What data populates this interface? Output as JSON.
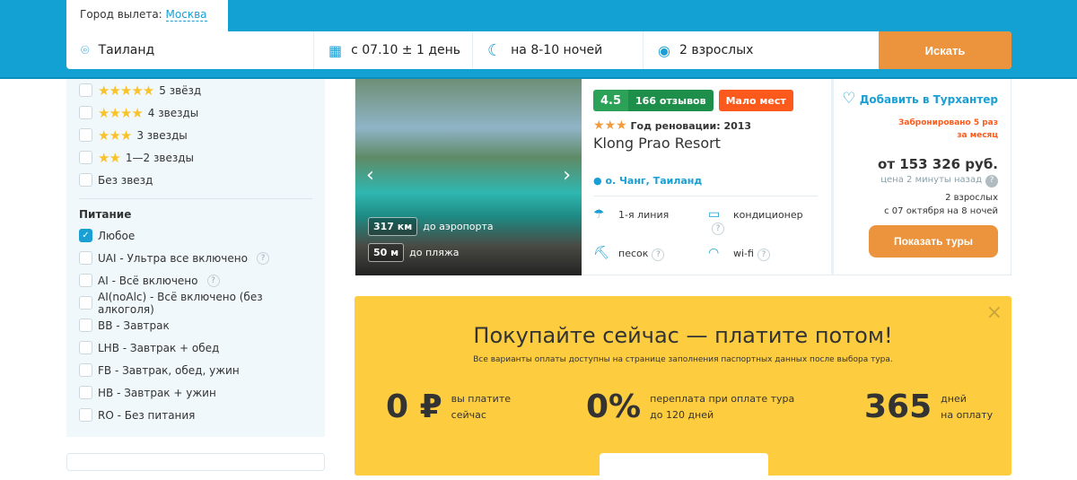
{
  "header": {
    "city_label": "Город вылета:",
    "city_value": "Москва",
    "destination": "Таиланд",
    "date": "с 07.10 ± 1 день",
    "nights": "на 8-10 ночей",
    "guests": "2 взрослых",
    "search_label": "Искать"
  },
  "sidebar": {
    "stars": [
      {
        "count": 5,
        "label": "5 звёзд"
      },
      {
        "count": 4,
        "label": "4 звезды"
      },
      {
        "count": 3,
        "label": "3 звезды"
      },
      {
        "count": 2,
        "label": "1—2 звезды"
      },
      {
        "count": 0,
        "label": "Без звезд"
      }
    ],
    "meal_title": "Питание",
    "meals": [
      {
        "label": "Любое",
        "checked": true
      },
      {
        "label": "UAI - Ультра все включено",
        "help": true
      },
      {
        "label": "AI - Всё включено",
        "help": true
      },
      {
        "label": "AI(noAlc) - Всё включено (без алкоголя)"
      },
      {
        "label": "BB - Завтрак"
      },
      {
        "label": "LHB - Завтрак + обед"
      },
      {
        "label": "FB - Завтрак, обед, ужин"
      },
      {
        "label": "HB - Завтрак + ужин"
      },
      {
        "label": "RO - Без питания"
      }
    ]
  },
  "hotel": {
    "rating": "4.5",
    "reviews": "166 отзывов",
    "few_places": "Мало мест",
    "stars": 3,
    "renovation": "Год реновации: 2013",
    "name": "Klong Prao Resort",
    "location": "о. Чанг, Таиланд",
    "airport_km": "317 км",
    "airport_label": "до аэропорта",
    "beach_m": "50 м",
    "beach_label": "до пляжа",
    "amenities": [
      "1-я линия",
      "кондиционер",
      "песок",
      "wi-fi"
    ],
    "favorite": "Добавить в Турхантер",
    "booked": "Забронировано 5 раз",
    "booked2": "за месяц",
    "price": "от 153 326 руб.",
    "price_age": "цена 2 минуты назад",
    "guests": "2 взрослых",
    "dates": "с 07 октября на 8 ночей",
    "show_tours": "Показать туры"
  },
  "promo": {
    "title": "Покупайте сейчас — платите потом!",
    "subtitle": "Все варианты оплаты доступны на странице заполнения паспортных данных после выбора тура.",
    "stats": [
      {
        "big": "0 ₽",
        "l1": "вы платите",
        "l2": "сейчас"
      },
      {
        "big": "0%",
        "l1": "переплата при оплате тура",
        "l2": "до 120 дней"
      },
      {
        "big": "365",
        "l1": "дней",
        "l2": "на оплату"
      }
    ],
    "close": "×"
  },
  "colors": {
    "header": "#12a1d2",
    "accent": "#ec943d",
    "promo": "#fdcd3f"
  }
}
